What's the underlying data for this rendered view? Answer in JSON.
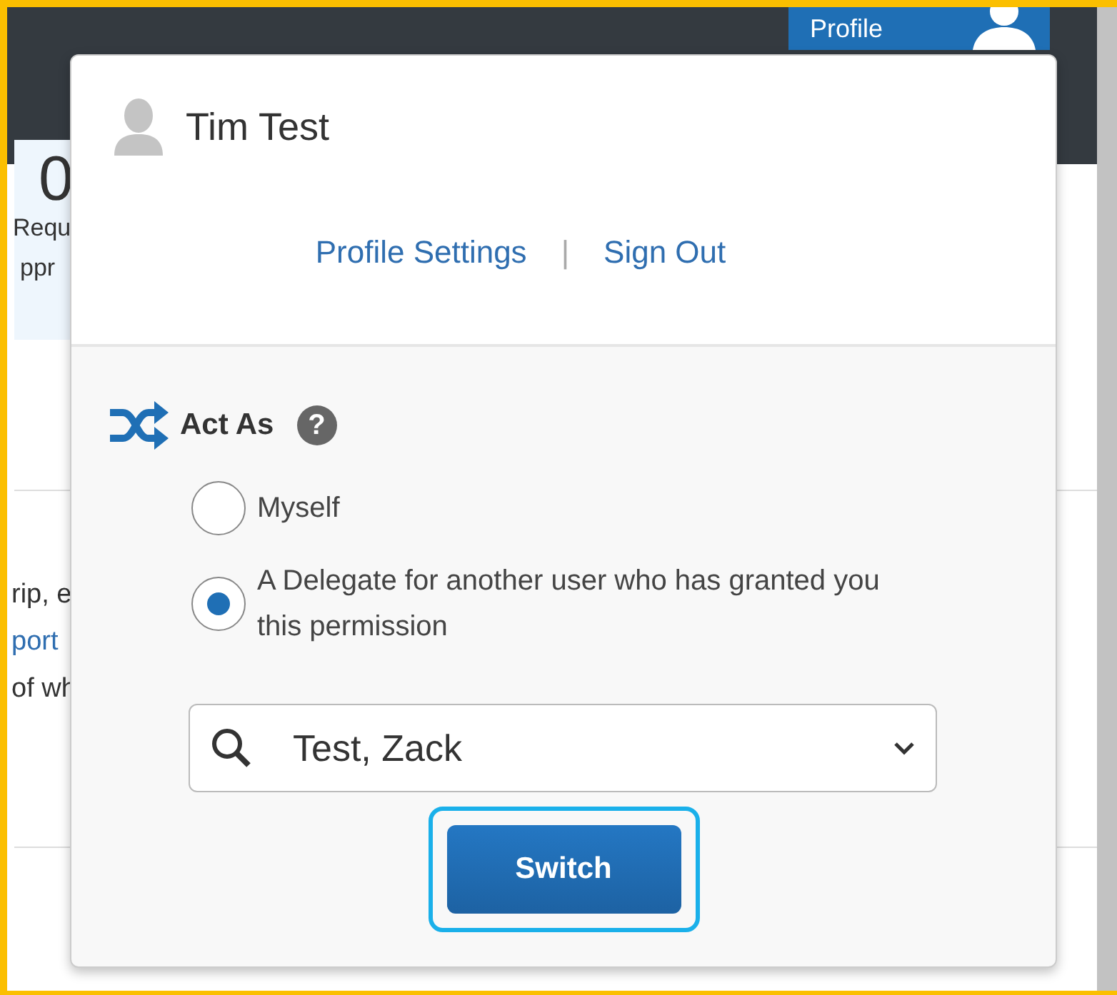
{
  "header": {
    "profile_button": "Profile"
  },
  "background": {
    "tile": {
      "count": "0",
      "lines": [
        "Requ",
        "ppr"
      ]
    },
    "text_lines": [
      {
        "text": "rip, e",
        "kind": "plain"
      },
      {
        "text": "port",
        "kind": "link"
      },
      {
        "text": "of wh",
        "kind": "plain"
      }
    ]
  },
  "popup": {
    "user_name": "Tim Test",
    "links": [
      "Profile Settings",
      "Sign Out"
    ],
    "separator": "|",
    "act_as": {
      "title": "Act As",
      "help": "?",
      "options": [
        {
          "label": "Myself",
          "selected": false
        },
        {
          "label": "A Delegate for another user who has granted you this permission",
          "selected": true
        }
      ],
      "delegate_field": {
        "value": "Test, Zack"
      },
      "button": {
        "label": "Switch",
        "focused": true
      }
    }
  }
}
